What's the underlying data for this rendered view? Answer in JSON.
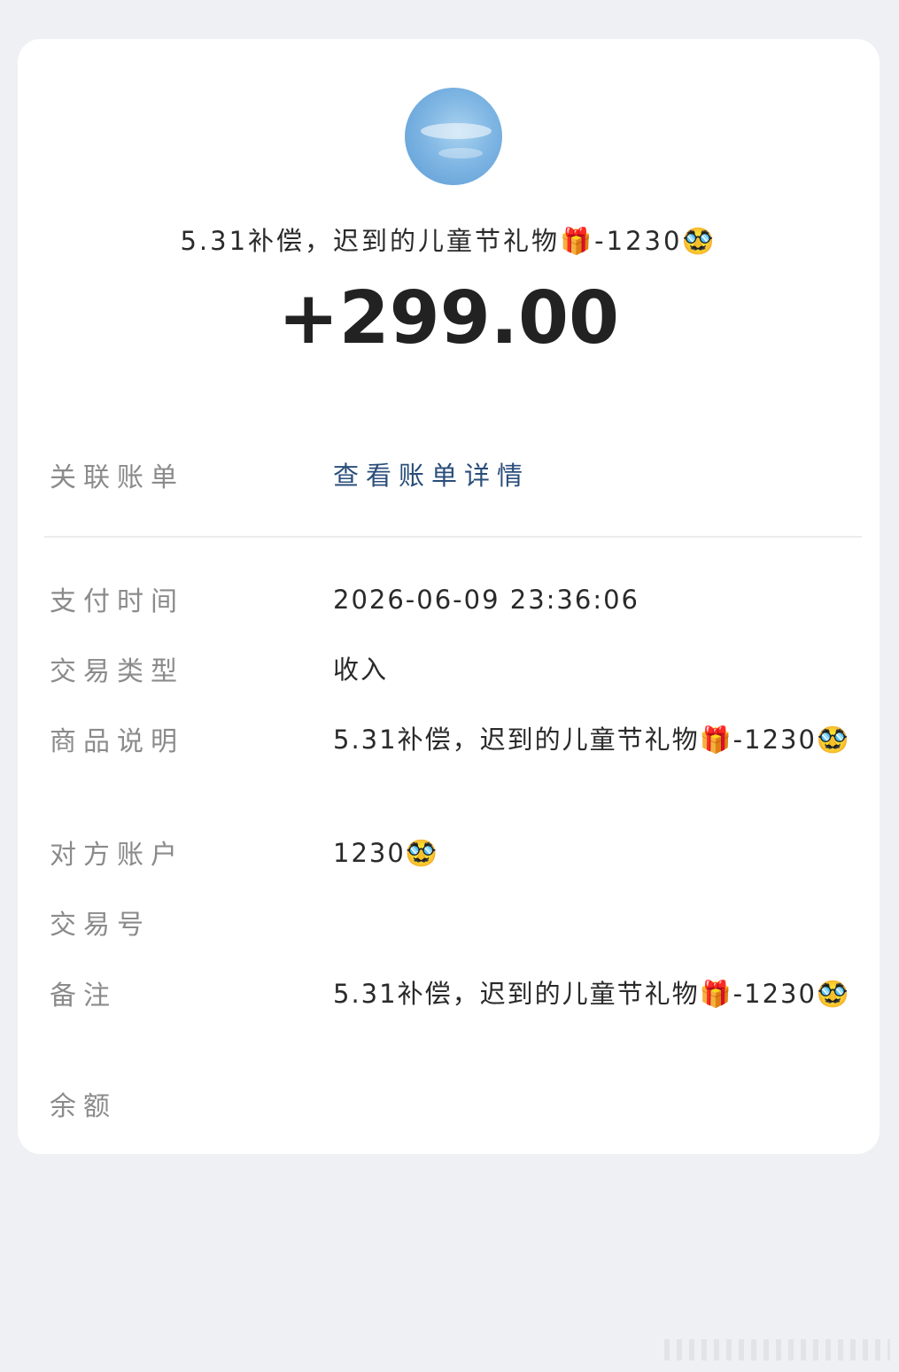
{
  "header": {
    "title": "5.31补偿，迟到的儿童节礼物🎁-1230🥸",
    "amount": "+299.00"
  },
  "linked_bill": {
    "label": "关联账单",
    "link_text": "查看账单详情"
  },
  "details": [
    {
      "label": "支付时间",
      "value": "2026-06-09  23:36:06"
    },
    {
      "label": "交易类型",
      "value": "收入"
    },
    {
      "label": "商品说明",
      "value": "5.31补偿，迟到的儿童节礼物🎁-1230🥸"
    },
    {
      "label": "对方账户",
      "value": "1230🥸"
    },
    {
      "label": "交易号",
      "value": ""
    },
    {
      "label": "备注",
      "value": "5.31补偿，迟到的儿童节礼物🎁-1230🥸"
    },
    {
      "label": "余额",
      "value": ""
    }
  ],
  "colors": {
    "background": "#eef0f4",
    "card": "#ffffff",
    "link": "#294d7a",
    "label": "#8b8b8b",
    "text": "#2a2a2a"
  }
}
